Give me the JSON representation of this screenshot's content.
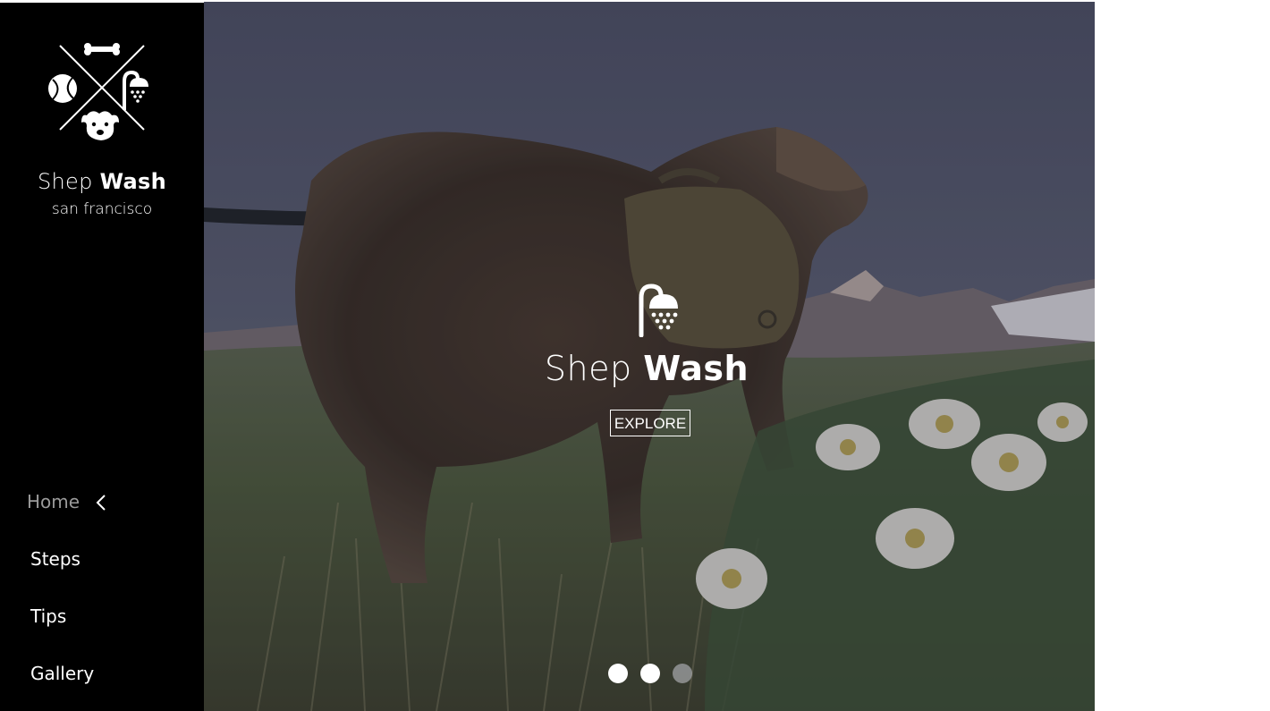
{
  "brand": {
    "name_first": "Shep",
    "name_second": "Wash",
    "city": "san francisco",
    "logo_icon": "crossed-dog-wash-logo-icon"
  },
  "nav": {
    "items": [
      {
        "label": "Home",
        "active": true
      },
      {
        "label": "Steps",
        "active": false
      },
      {
        "label": "Tips",
        "active": false
      },
      {
        "label": "Gallery",
        "active": false
      }
    ]
  },
  "hero": {
    "title_first": "Shep",
    "title_second": "Wash",
    "button_label": "EXPLORE",
    "icon": "shower-icon",
    "background": "dog-with-backpack-in-mountain-meadow-photo"
  },
  "carousel": {
    "dot_count": 3,
    "active_index": 2
  },
  "colors": {
    "sidebar": "#000000",
    "text": "#ffffff",
    "nav_active": "#9a9a9a"
  }
}
